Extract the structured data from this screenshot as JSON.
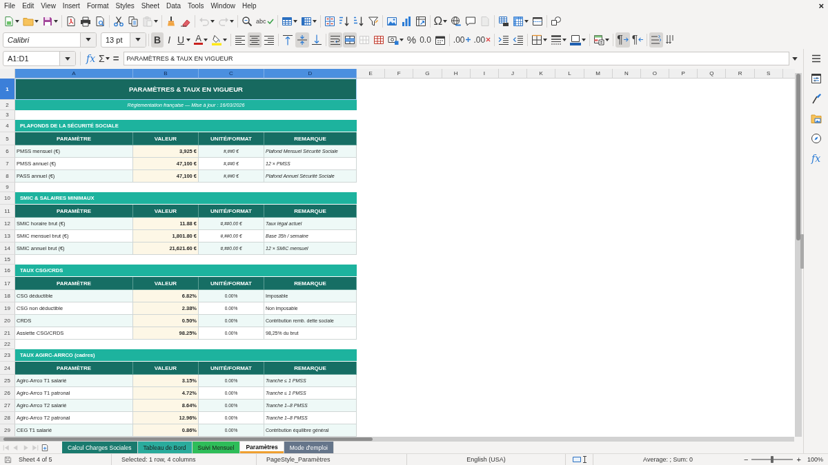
{
  "menu_bar": {
    "items": [
      "File",
      "Edit",
      "View",
      "Insert",
      "Format",
      "Styles",
      "Sheet",
      "Data",
      "Tools",
      "Window",
      "Help"
    ],
    "close": "×"
  },
  "standard_toolbar": {
    "groups": [
      [
        {
          "kind": "new-spreadsheet",
          "dropdown": true,
          "disabled": false
        },
        {
          "kind": "open",
          "dropdown": true,
          "disabled": false
        },
        {
          "kind": "save",
          "dropdown": true,
          "disabled": false
        }
      ],
      [
        {
          "kind": "export-pdf",
          "dropdown": false,
          "disabled": false
        },
        {
          "kind": "print",
          "dropdown": false,
          "disabled": false
        },
        {
          "kind": "print-preview",
          "dropdown": false,
          "disabled": false
        }
      ],
      [
        {
          "kind": "cut",
          "dropdown": false,
          "disabled": false
        },
        {
          "kind": "copy",
          "dropdown": false,
          "disabled": false
        },
        {
          "kind": "paste",
          "dropdown": true,
          "disabled": true
        }
      ],
      [
        {
          "kind": "clone-formatting",
          "dropdown": false,
          "disabled": false
        },
        {
          "kind": "clear-formatting",
          "dropdown": false,
          "disabled": false
        }
      ],
      [
        {
          "kind": "undo",
          "dropdown": true,
          "disabled": true
        },
        {
          "kind": "redo",
          "dropdown": true,
          "disabled": true
        }
      ],
      [
        {
          "kind": "find-replace",
          "dropdown": false,
          "disabled": false
        },
        {
          "kind": "spelling",
          "label": "abc",
          "dropdown": false,
          "disabled": false
        }
      ],
      [
        {
          "kind": "rows",
          "dropdown": true,
          "disabled": false
        },
        {
          "kind": "columns",
          "dropdown": true,
          "disabled": false
        }
      ],
      [
        {
          "kind": "sort",
          "dropdown": false,
          "disabled": false
        },
        {
          "kind": "sort-ascending",
          "dropdown": false,
          "disabled": false
        },
        {
          "kind": "sort-descending",
          "dropdown": false,
          "disabled": false
        },
        {
          "kind": "autofilter",
          "dropdown": false,
          "disabled": false
        }
      ],
      [
        {
          "kind": "image",
          "dropdown": false,
          "disabled": false
        },
        {
          "kind": "chart",
          "dropdown": false,
          "disabled": false
        },
        {
          "kind": "pivot-table",
          "dropdown": false,
          "disabled": false
        }
      ],
      [
        {
          "kind": "special-character",
          "label": "Ω",
          "dropdown": true,
          "disabled": false
        },
        {
          "kind": "hyperlink",
          "dropdown": false,
          "disabled": false
        },
        {
          "kind": "comment",
          "dropdown": false,
          "disabled": false
        },
        {
          "kind": "headers-footers",
          "dropdown": false,
          "disabled": true
        }
      ],
      [
        {
          "kind": "print-range",
          "dropdown": false,
          "disabled": false
        },
        {
          "kind": "freeze-panes",
          "dropdown": true,
          "disabled": false
        },
        {
          "kind": "split-window",
          "dropdown": false,
          "disabled": false
        }
      ],
      [
        {
          "kind": "draw-functions",
          "dropdown": false,
          "disabled": false
        }
      ]
    ]
  },
  "formatting_toolbar": {
    "font_name": "Calibri",
    "font_size": "13 pt",
    "groups": [
      [
        {
          "kind": "bold",
          "label": "B",
          "dropdown": false,
          "on": true,
          "disabled": false
        },
        {
          "kind": "italic",
          "label": "I",
          "dropdown": false,
          "on": false,
          "disabled": false
        },
        {
          "kind": "underline",
          "label": "U",
          "dropdown": true,
          "on": false,
          "disabled": false
        },
        {
          "kind": "font-color",
          "label": "A",
          "dropdown": true,
          "on": false,
          "disabled": false
        },
        {
          "kind": "highlighting",
          "dropdown": true,
          "on": false,
          "disabled": false
        }
      ],
      [
        {
          "kind": "align-left",
          "dropdown": false,
          "on": false,
          "disabled": false
        },
        {
          "kind": "align-center",
          "dropdown": false,
          "on": true,
          "disabled": false
        },
        {
          "kind": "align-right",
          "dropdown": false,
          "on": false,
          "disabled": false
        }
      ],
      [
        {
          "kind": "align-top",
          "dropdown": false,
          "on": false,
          "disabled": false
        },
        {
          "kind": "align-middle",
          "dropdown": false,
          "on": true,
          "disabled": false
        },
        {
          "kind": "align-bottom",
          "dropdown": false,
          "on": false,
          "disabled": false
        }
      ],
      [
        {
          "kind": "wrap-text",
          "dropdown": false,
          "on": true,
          "disabled": false
        },
        {
          "kind": "merge-center",
          "dropdown": false,
          "on": true,
          "disabled": false
        },
        {
          "kind": "merge-cells",
          "dropdown": false,
          "on": false,
          "disabled": true
        },
        {
          "kind": "unmerge-cells",
          "dropdown": false,
          "on": false,
          "disabled": false
        },
        {
          "kind": "number-format",
          "dropdown": true,
          "on": false,
          "disabled": false
        },
        {
          "kind": "percent",
          "label": "%",
          "dropdown": false,
          "on": false,
          "disabled": false
        },
        {
          "kind": "standard-number",
          "label": "0.0",
          "dropdown": false,
          "on": false,
          "disabled": false
        },
        {
          "kind": "date",
          "dropdown": false,
          "on": false,
          "disabled": false
        }
      ],
      [
        {
          "kind": "add-decimal",
          "label": ".00",
          "dropdown": false,
          "on": false,
          "disabled": false
        },
        {
          "kind": "delete-decimal",
          "label": ".00",
          "dropdown": false,
          "on": false,
          "disabled": false
        }
      ],
      [
        {
          "kind": "increase-indent",
          "dropdown": false,
          "on": false,
          "disabled": false
        },
        {
          "kind": "decrease-indent",
          "dropdown": false,
          "on": false,
          "disabled": false
        }
      ],
      [
        {
          "kind": "borders",
          "dropdown": true,
          "on": false,
          "disabled": false
        },
        {
          "kind": "border-style",
          "dropdown": true,
          "on": false,
          "disabled": false
        },
        {
          "kind": "border-color",
          "dropdown": true,
          "on": false,
          "disabled": false
        }
      ],
      [
        {
          "kind": "conditional-format",
          "dropdown": true,
          "on": false,
          "disabled": false
        }
      ],
      [
        {
          "kind": "left-to-right",
          "label": "¶",
          "dropdown": false,
          "on": true,
          "disabled": false
        },
        {
          "kind": "right-to-left",
          "label": "¶",
          "dropdown": false,
          "on": false,
          "disabled": false
        }
      ],
      [
        {
          "kind": "text-left-to-right",
          "dropdown": false,
          "on": true,
          "disabled": false
        },
        {
          "kind": "text-top-to-bottom",
          "dropdown": false,
          "on": false,
          "disabled": false
        }
      ]
    ]
  },
  "formula_bar": {
    "name_box": "A1:D1",
    "buttons": [
      {
        "kind": "function-wizard",
        "label": "fx",
        "dropdown": false
      },
      {
        "kind": "sum",
        "label": "Σ",
        "dropdown": true
      },
      {
        "kind": "formula",
        "label": "=",
        "dropdown": false
      }
    ],
    "content": "PARAMÈTRES & TAUX EN VIGUEUR"
  },
  "sheet": {
    "columns": [
      {
        "label": "A",
        "selected": true
      },
      {
        "label": "B",
        "selected": true
      },
      {
        "label": "C",
        "selected": true
      },
      {
        "label": "D",
        "selected": true
      },
      {
        "label": "E",
        "selected": false
      },
      {
        "label": "F",
        "selected": false
      },
      {
        "label": "G",
        "selected": false
      },
      {
        "label": "H",
        "selected": false
      },
      {
        "label": "I",
        "selected": false
      },
      {
        "label": "J",
        "selected": false
      },
      {
        "label": "K",
        "selected": false
      },
      {
        "label": "L",
        "selected": false
      },
      {
        "label": "M",
        "selected": false
      },
      {
        "label": "N",
        "selected": false
      },
      {
        "label": "O",
        "selected": false
      },
      {
        "label": "P",
        "selected": false
      },
      {
        "label": "Q",
        "selected": false
      },
      {
        "label": "R",
        "selected": false
      },
      {
        "label": "S",
        "selected": false
      }
    ],
    "rows": [
      {
        "number": "1",
        "selected": true,
        "kind": "title",
        "text": "PARAMÈTRES & TAUX EN VIGUEUR"
      },
      {
        "number": "2",
        "selected": false,
        "kind": "subtitle",
        "text": "Réglementation française — Mise à jour : 16/03/2026"
      },
      {
        "number": "3",
        "selected": false,
        "kind": "blank"
      },
      {
        "number": "4",
        "selected": false,
        "kind": "section",
        "text": "PLAFONDS DE LA SÉCURITÉ SOCIALE"
      },
      {
        "number": "5",
        "selected": false,
        "kind": "header",
        "cells": [
          "PARAMÈTRE",
          "VALEUR",
          "UNITÉ/FORMAT",
          "REMARQUE"
        ]
      },
      {
        "number": "6",
        "selected": false,
        "kind": "data",
        "cells": [
          "PMSS mensuel (€)",
          "3,925 €",
          "#,##0 €",
          "Plafond Mensuel Sécurité Sociale"
        ],
        "format_italic": true,
        "remark_italic": true
      },
      {
        "number": "7",
        "selected": false,
        "kind": "data",
        "cells": [
          "PMSS annuel (€)",
          "47,100 €",
          "#,##0 €",
          "12 × PMSS"
        ],
        "format_italic": true,
        "remark_italic": true
      },
      {
        "number": "8",
        "selected": false,
        "kind": "data",
        "cells": [
          "PASS annuel (€)",
          "47,100 €",
          "#,##0 €",
          "Plafond Annuel Sécurité Sociale"
        ],
        "format_italic": true,
        "remark_italic": true
      },
      {
        "number": "9",
        "selected": false,
        "kind": "blank"
      },
      {
        "number": "10",
        "selected": false,
        "kind": "section",
        "text": "SMIC & SALAIRES MINIMAUX"
      },
      {
        "number": "11",
        "selected": false,
        "kind": "header",
        "cells": [
          "PARAMÈTRE",
          "VALEUR",
          "UNITÉ/FORMAT",
          "REMARQUE"
        ]
      },
      {
        "number": "12",
        "selected": false,
        "kind": "data",
        "cells": [
          "SMIC horaire brut (€)",
          "11.88 €",
          "#,##0.00 €",
          "Taux légal actuel"
        ],
        "format_italic": true,
        "remark_italic": true
      },
      {
        "number": "13",
        "selected": false,
        "kind": "data",
        "cells": [
          "SMIC mensuel brut (€)",
          "1,801.80 €",
          "#,##0.00 €",
          "Base 35h / semaine"
        ],
        "format_italic": true,
        "remark_italic": true
      },
      {
        "number": "14",
        "selected": false,
        "kind": "data",
        "cells": [
          "SMIC annuel brut (€)",
          "21,621.60 €",
          "#,##0.00 €",
          "12 × SMIC mensuel"
        ],
        "format_italic": true,
        "remark_italic": true
      },
      {
        "number": "15",
        "selected": false,
        "kind": "blank"
      },
      {
        "number": "16",
        "selected": false,
        "kind": "section",
        "text": "TAUX CSG/CRDS"
      },
      {
        "number": "17",
        "selected": false,
        "kind": "header",
        "cells": [
          "PARAMÈTRE",
          "VALEUR",
          "UNITÉ/FORMAT",
          "REMARQUE"
        ]
      },
      {
        "number": "18",
        "selected": false,
        "kind": "data",
        "cells": [
          "CSG déductible",
          "6.82%",
          "0.00%",
          "Imposable"
        ],
        "format_italic": false,
        "remark_italic": false
      },
      {
        "number": "19",
        "selected": false,
        "kind": "data",
        "cells": [
          "CSG non déductible",
          "2.38%",
          "0.00%",
          "Non imposable"
        ],
        "format_italic": false,
        "remark_italic": false
      },
      {
        "number": "20",
        "selected": false,
        "kind": "data",
        "cells": [
          "CRDS",
          "0.50%",
          "0.00%",
          "Contribution remb. dette sociale"
        ],
        "format_italic": false,
        "remark_italic": false
      },
      {
        "number": "21",
        "selected": false,
        "kind": "data",
        "cells": [
          "Assiette CSG/CRDS",
          "98.25%",
          "0.00%",
          "98,25% du brut"
        ],
        "format_italic": false,
        "remark_italic": false
      },
      {
        "number": "22",
        "selected": false,
        "kind": "blank"
      },
      {
        "number": "23",
        "selected": false,
        "kind": "section",
        "text": "TAUX AGIRC-ARRCO (cadres)"
      },
      {
        "number": "24",
        "selected": false,
        "kind": "header",
        "cells": [
          "PARAMÈTRE",
          "VALEUR",
          "UNITÉ/FORMAT",
          "REMARQUE"
        ]
      },
      {
        "number": "25",
        "selected": false,
        "kind": "data",
        "cells": [
          "Agirc-Arrco T1 salarié",
          "3.15%",
          "0.00%",
          "Tranche ≤ 1 PMSS"
        ],
        "format_italic": false,
        "remark_italic": true
      },
      {
        "number": "26",
        "selected": false,
        "kind": "data",
        "cells": [
          "Agirc-Arrco T1 patronal",
          "4.72%",
          "0.00%",
          "Tranche ≤ 1 PMSS"
        ],
        "format_italic": false,
        "remark_italic": true
      },
      {
        "number": "27",
        "selected": false,
        "kind": "data",
        "cells": [
          "Agirc-Arrco T2 salarié",
          "8.64%",
          "0.00%",
          "Tranche 1–8 PMSS"
        ],
        "format_italic": false,
        "remark_italic": true
      },
      {
        "number": "28",
        "selected": false,
        "kind": "data",
        "cells": [
          "Agirc-Arrco T2 patronal",
          "12.96%",
          "0.00%",
          "Tranche 1–8 PMSS"
        ],
        "format_italic": false,
        "remark_italic": true
      },
      {
        "number": "29",
        "selected": false,
        "kind": "data",
        "cells": [
          "CEG T1 salarié",
          "0.86%",
          "0.00%",
          "Contribution équilibre général"
        ],
        "format_italic": false,
        "remark_italic": false
      }
    ]
  },
  "sidebar": {
    "buttons": [
      {
        "kind": "menu"
      },
      {
        "kind": "properties"
      },
      {
        "kind": "styles"
      },
      {
        "kind": "gallery"
      },
      {
        "kind": "navigator"
      },
      {
        "kind": "functions",
        "label": "fx"
      }
    ]
  },
  "sheet_tabs": {
    "nav": [
      {
        "kind": "first-sheet",
        "disabled": true
      },
      {
        "kind": "previous-sheet",
        "disabled": true
      },
      {
        "kind": "next-sheet",
        "disabled": true
      },
      {
        "kind": "last-sheet",
        "disabled": true
      },
      {
        "kind": "add-sheet",
        "disabled": false
      }
    ],
    "tabs": [
      {
        "label": "Calcul Charges Sociales",
        "selected": false,
        "color": "#1a7a6e"
      },
      {
        "label": "Tableau de Bord",
        "selected": false,
        "color": "#2aab9c"
      },
      {
        "label": "Suivi Mensuel",
        "selected": false,
        "color": "#2ebd59"
      },
      {
        "label": "Paramètres",
        "selected": true,
        "color": "#f0a030"
      },
      {
        "label": "Mode d'emploi",
        "selected": false,
        "color": "#65758a"
      }
    ]
  },
  "status_bar": {
    "sheet": "Sheet 4 of 5",
    "selection": "Selected: 1 row, 4 columns",
    "page_style": "PageStyle_Paramètres",
    "language": "English (USA)",
    "sum": "Average: ; Sum: 0",
    "zoom_out": "−",
    "zoom_slider": {
      "level": 0.5
    },
    "zoom_in": "+",
    "zoom": "100%"
  }
}
